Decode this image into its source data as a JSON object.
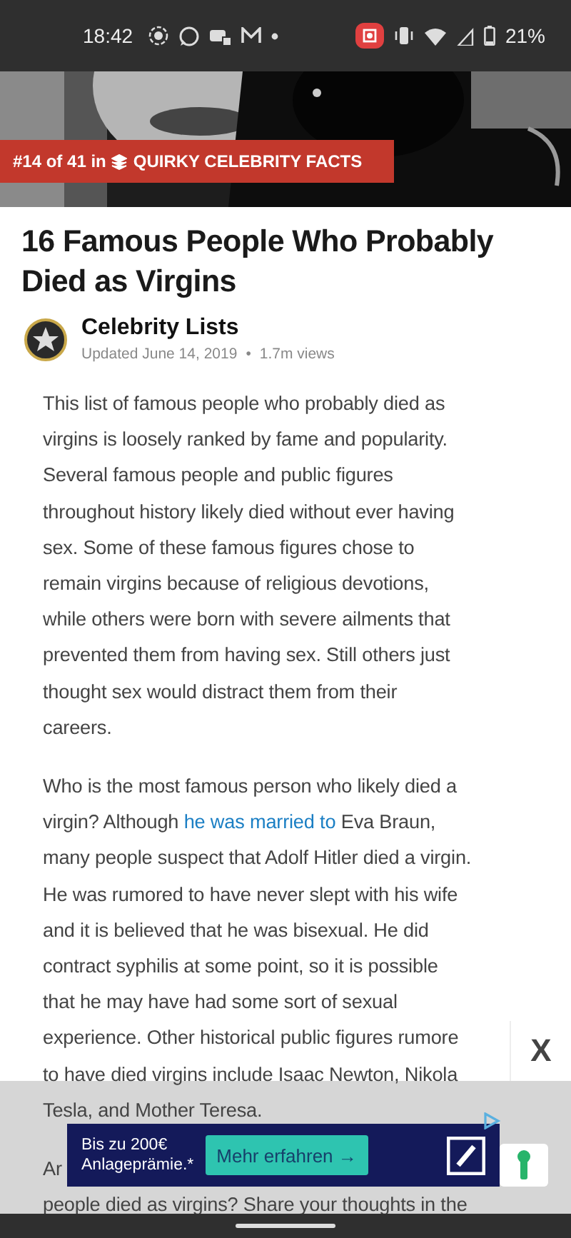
{
  "status_bar": {
    "time": "18:42",
    "battery": "21%"
  },
  "hero": {
    "kind": "picture",
    "badge": {
      "rank": "#14 of 41 in",
      "category": "QUIRKY CELEBRITY FACTS"
    }
  },
  "title": "16 Famous People Who Probably Died as Virgins",
  "author": {
    "name": "Celebrity Lists",
    "updated": "Updated June 14, 2019",
    "separator": "•",
    "views": "1.7m views"
  },
  "paragraphs": [
    {
      "kind": "whole",
      "lines": [
        [
          {
            "kind": "text",
            "text": "This list of famous people who probably died as"
          }
        ],
        [
          {
            "kind": "text",
            "text": "virgins is loosely ranked by fame and popularity."
          }
        ],
        [
          {
            "kind": "text",
            "text": "Several famous people and public figures"
          }
        ],
        [
          {
            "kind": "text",
            "text": "throughout history likely died without ever having"
          }
        ],
        [
          {
            "kind": "text",
            "text": "sex. Some of these famous figures chose to"
          }
        ],
        [
          {
            "kind": "text",
            "text": "remain virgins because of religious devotions,"
          }
        ],
        [
          {
            "kind": "text",
            "text": "while others were born with severe ailments that"
          }
        ],
        [
          {
            "kind": "text",
            "text": "prevented them from having sex. Still others just"
          }
        ],
        [
          {
            "kind": "text",
            "text": "thought sex would distract them from their"
          }
        ],
        [
          {
            "kind": "text",
            "text": "careers."
          }
        ]
      ]
    },
    {
      "kind": "whole",
      "lines": [
        [
          {
            "kind": "text",
            "text": "Who is the most famous person who likely died a"
          }
        ],
        [
          {
            "kind": "text",
            "text": "virgin? Although "
          },
          {
            "kind": "link",
            "text": "he was married to"
          },
          {
            "kind": "text",
            "text": " Eva Braun,"
          }
        ],
        [
          {
            "kind": "text",
            "text": "many people suspect that Adolf Hitler died a virgin."
          }
        ],
        [
          {
            "kind": "text",
            "text": "He was rumored to have never slept with his wife"
          }
        ],
        [
          {
            "kind": "text",
            "text": "and it is believed that he was bisexual. He did"
          }
        ],
        [
          {
            "kind": "text",
            "text": "contract syphilis at some point, so it is possible"
          }
        ],
        [
          {
            "kind": "text",
            "text": "that he may have had some sort of sexual"
          }
        ],
        [
          {
            "kind": "text",
            "text": "experience. Other historical public figures rumore"
          }
        ],
        [
          {
            "kind": "text",
            "text": "to have died virgins include Isaac Newton, Nikola"
          }
        ],
        [
          {
            "kind": "text",
            "text": "Tesla, and Mother Teresa."
          }
        ]
      ]
    },
    {
      "kind": "partial",
      "lines": [
        [
          {
            "kind": "text",
            "text": "Ar"
          }
        ],
        [
          {
            "kind": "text",
            "text": "people died as virgins? Share your thoughts in the"
          }
        ]
      ]
    }
  ],
  "ad": {
    "headline": [
      "Bis zu 200€",
      "Anlageprämie.*"
    ],
    "button": "Mehr erfahren →"
  },
  "close_button": "X"
}
